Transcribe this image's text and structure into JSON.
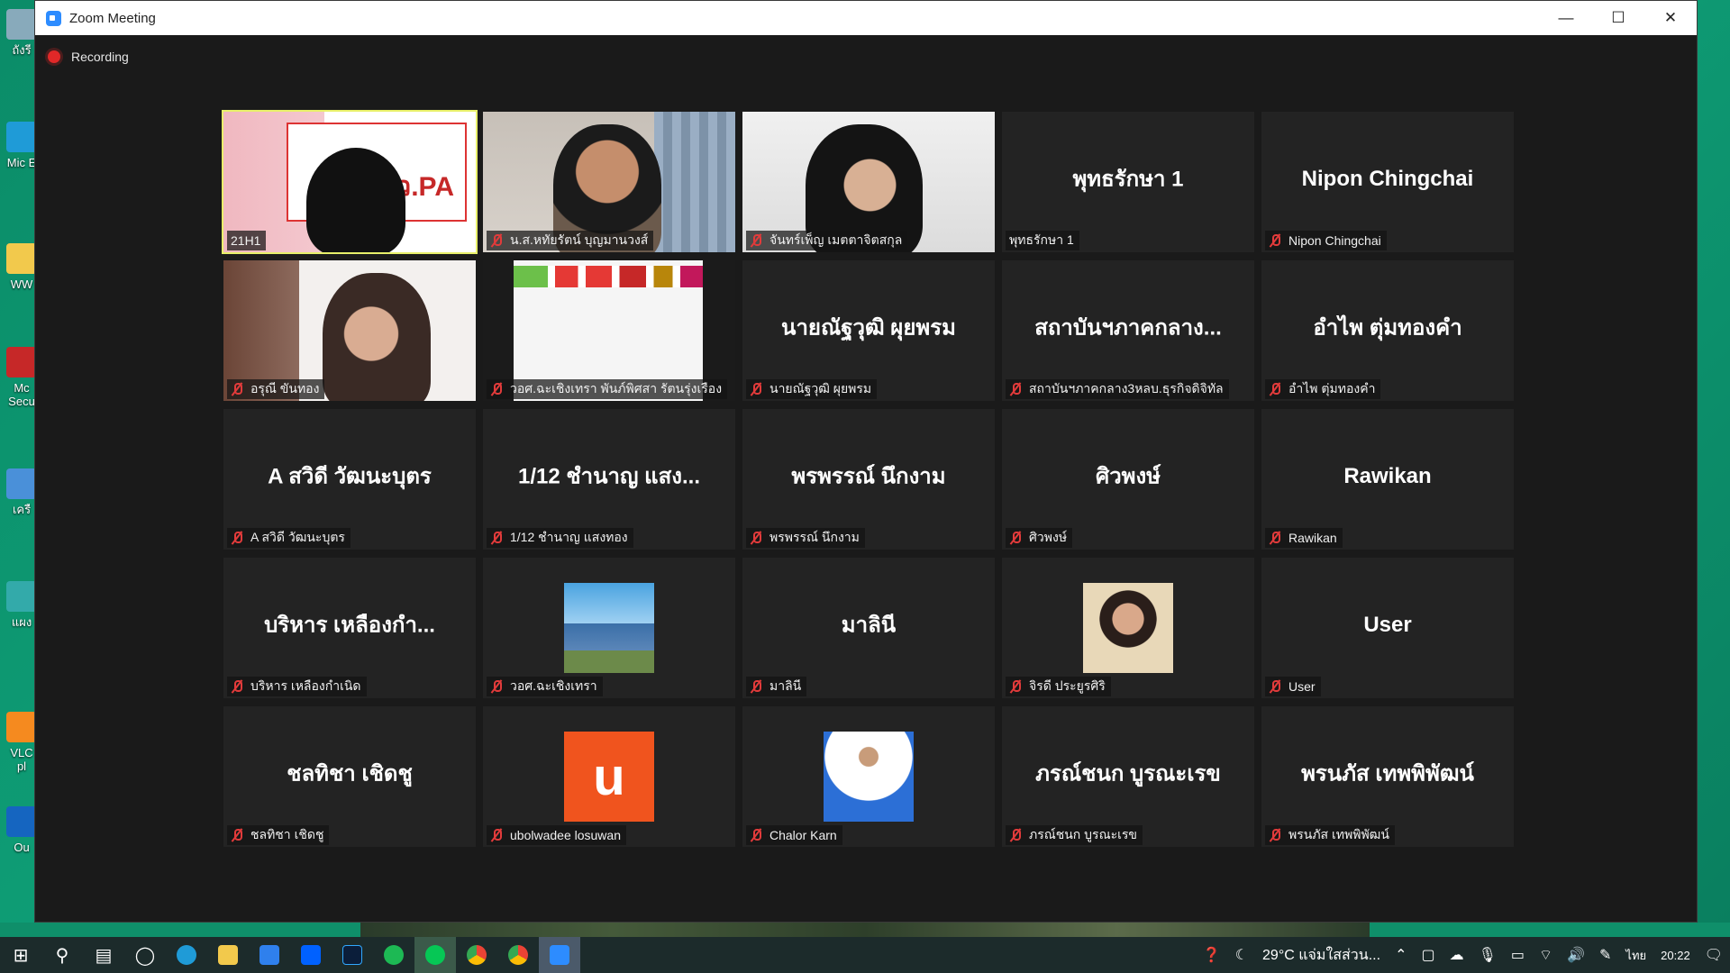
{
  "window": {
    "title": "Zoom Meeting",
    "minimize_label": "—",
    "maximize_label": "☐",
    "close_label": "✕"
  },
  "recording": {
    "label": "Recording"
  },
  "desktop_icons": [
    {
      "label": "ถังรี"
    },
    {
      "label": "Mic E"
    },
    {
      "label": "WW"
    },
    {
      "label": "Mc Secu"
    },
    {
      "label": "เครื"
    },
    {
      "label": "แผง"
    },
    {
      "label": "VLC pl"
    },
    {
      "label": "Ou"
    }
  ],
  "participants": [
    {
      "tile_name": "",
      "label": "21H1",
      "muted": false,
      "kind": "video1",
      "active": true
    },
    {
      "tile_name": "",
      "label": "น.ส.หทัยรัตน์ บุญมานวงส์",
      "muted": true,
      "kind": "video2"
    },
    {
      "tile_name": "",
      "label": "จันทร์เพ็ญ เมตตาจิตสกุล",
      "muted": true,
      "kind": "video3"
    },
    {
      "tile_name": "พุทธรักษา 1",
      "label": "พุทธรักษา 1",
      "muted": false,
      "kind": "name"
    },
    {
      "tile_name": "Nipon Chingchai",
      "label": "Nipon Chingchai",
      "muted": true,
      "kind": "name"
    },
    {
      "tile_name": "",
      "label": "อรุณี ขันทอง",
      "muted": true,
      "kind": "video4"
    },
    {
      "tile_name": "",
      "label": "วอศ.ฉะเชิงเทรา พันภ์พิศสา รัตนรุ่งเรือง",
      "muted": true,
      "kind": "video5"
    },
    {
      "tile_name": "นายณัฐวุฒิ ผุยพรม",
      "label": "นายณัฐวุฒิ ผุยพรม",
      "muted": true,
      "kind": "name"
    },
    {
      "tile_name": "สถาบันฯภาคกลาง...",
      "label": "สถาบันฯภาคกลาง3หลบ.ธุรกิจดิจิทัล",
      "muted": true,
      "kind": "name"
    },
    {
      "tile_name": "อำไพ ตุ่มทองคำ",
      "label": "อำไพ ตุ่มทองคำ",
      "muted": true,
      "kind": "name"
    },
    {
      "tile_name": "A สวิดี วัฒนะบุตร",
      "label": "A สวิดี วัฒนะบุตร",
      "muted": true,
      "kind": "name"
    },
    {
      "tile_name": "1/12 ชำนาญ แสง...",
      "label": "1/12 ชำนาญ แสงทอง",
      "muted": true,
      "kind": "name"
    },
    {
      "tile_name": "พรพรรณ์ นึกงาม",
      "label": "พรพรรณ์ นึกงาม",
      "muted": true,
      "kind": "name"
    },
    {
      "tile_name": "ศิวพงษ์",
      "label": "ศิวพงษ์",
      "muted": true,
      "kind": "name"
    },
    {
      "tile_name": "Rawikan",
      "label": "Rawikan",
      "muted": true,
      "kind": "name"
    },
    {
      "tile_name": "บริหาร เหลืองกำ...",
      "label": "บริหาร เหลืองกำเนิด",
      "muted": true,
      "kind": "name"
    },
    {
      "tile_name": "",
      "label": "วอศ.ฉะเชิงเทรา",
      "muted": true,
      "kind": "avatar-building"
    },
    {
      "tile_name": "มาลินี",
      "label": "มาลินี",
      "muted": true,
      "kind": "name"
    },
    {
      "tile_name": "",
      "label": "จิรดี ประยูรศิริ",
      "muted": true,
      "kind": "avatar-woman"
    },
    {
      "tile_name": "User",
      "label": "User",
      "muted": true,
      "kind": "name"
    },
    {
      "tile_name": "ชลทิชา เชิดชู",
      "label": "ชลทิชา เชิดชู",
      "muted": true,
      "kind": "name"
    },
    {
      "tile_name": "",
      "label": "ubolwadee losuwan",
      "muted": true,
      "kind": "avatar-letter",
      "avatar_letter": "u"
    },
    {
      "tile_name": "",
      "label": "Chalor Karn",
      "muted": true,
      "kind": "avatar-officer"
    },
    {
      "tile_name": "ภรณ์ชนก บูรณะเรข",
      "label": "ภรณ์ชนก บูรณะเรข",
      "muted": true,
      "kind": "name"
    },
    {
      "tile_name": "พรนภัส เทพพิพัฒน์",
      "label": "พรนภัส เทพพิพัฒน์",
      "muted": true,
      "kind": "name"
    }
  ],
  "video_overlay_text": {
    "vid1_slide": "ว.PA"
  },
  "taskbar": {
    "apps": [
      "start-icon",
      "search-icon",
      "task-view-icon",
      "cortana-icon",
      "edge-icon",
      "file-explorer-icon",
      "mail-icon",
      "dropbox-icon",
      "photoshop-icon",
      "spotify-icon",
      "line-icon",
      "chrome-icon",
      "chrome-profile-icon",
      "zoom-icon"
    ],
    "weather": "29°C แจ่มใสส่วน...",
    "language": "ไทย",
    "time": "20:22"
  },
  "colors": {
    "active_speaker_border": "#e8f06a",
    "mute_red": "#e23b3b",
    "recording_red": "#e02828",
    "zoom_blue": "#2d8cff"
  }
}
